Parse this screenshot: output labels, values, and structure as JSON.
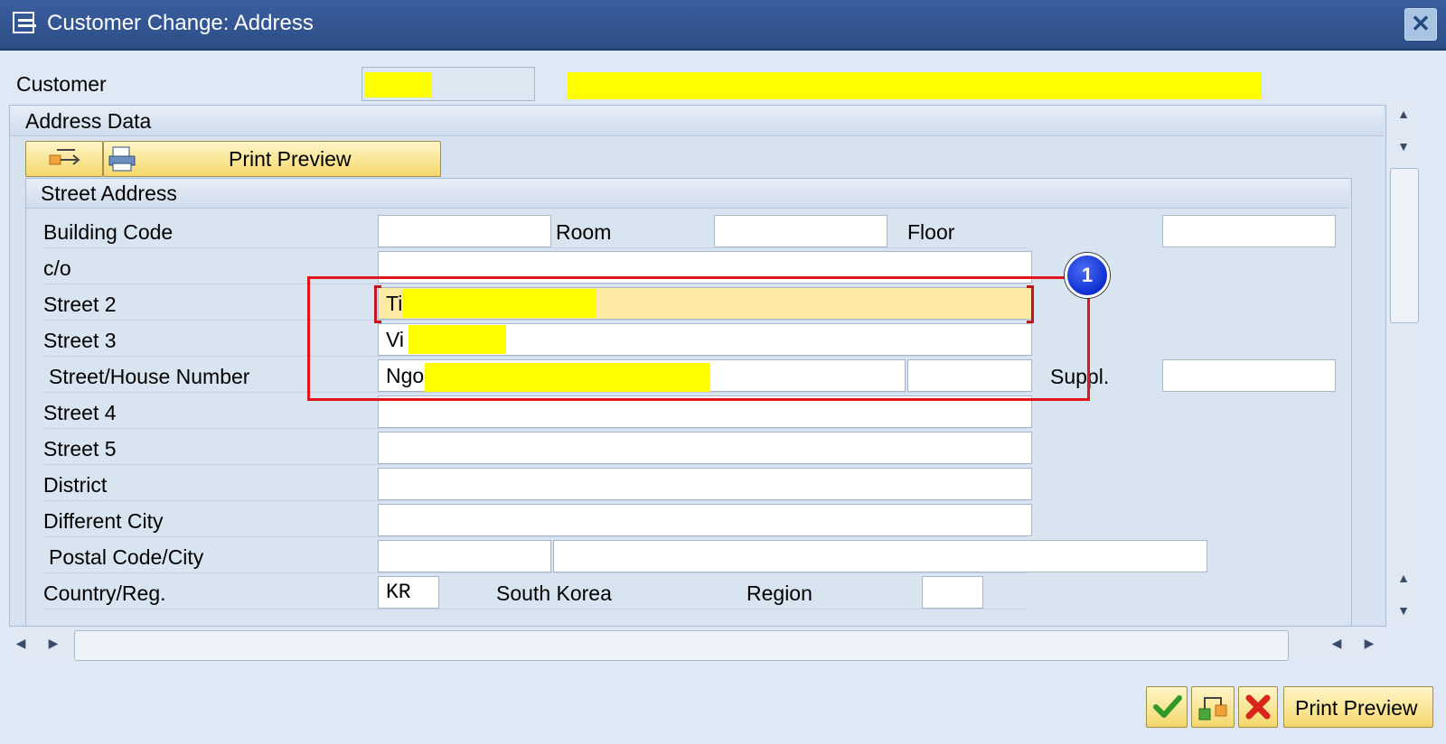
{
  "window": {
    "title": "Customer Change: Address",
    "close_symbol": "✕"
  },
  "customer": {
    "label": "Customer"
  },
  "address_data": {
    "title": "Address Data",
    "print_preview_label": "Print Preview"
  },
  "street_address": {
    "title": "Street Address",
    "labels": {
      "building_code": "Building Code",
      "room": "Room",
      "floor": "Floor",
      "co": "c/o",
      "street2": "Street 2",
      "street3": "Street 3",
      "street_house": "Street/House Number",
      "suppl": "Suppl.",
      "street4": "Street 4",
      "street5": "Street 5",
      "district": "District",
      "different_city": "Different City",
      "postal_city": "Postal Code/City",
      "country": "Country/Reg.",
      "region": "Region"
    },
    "values": {
      "street2": "Ti",
      "street3": "Vi",
      "street_house": "Ngo",
      "country_code": "KR",
      "country_name": "South Korea"
    }
  },
  "annotation": {
    "badge_number": "1",
    "color": "#e0161c"
  },
  "footer": {
    "print_preview_label": "Print Preview"
  },
  "colors": {
    "mask": "#ffff00",
    "title_bar": "#2c4d86",
    "button_yellow": "#f4d76b"
  }
}
